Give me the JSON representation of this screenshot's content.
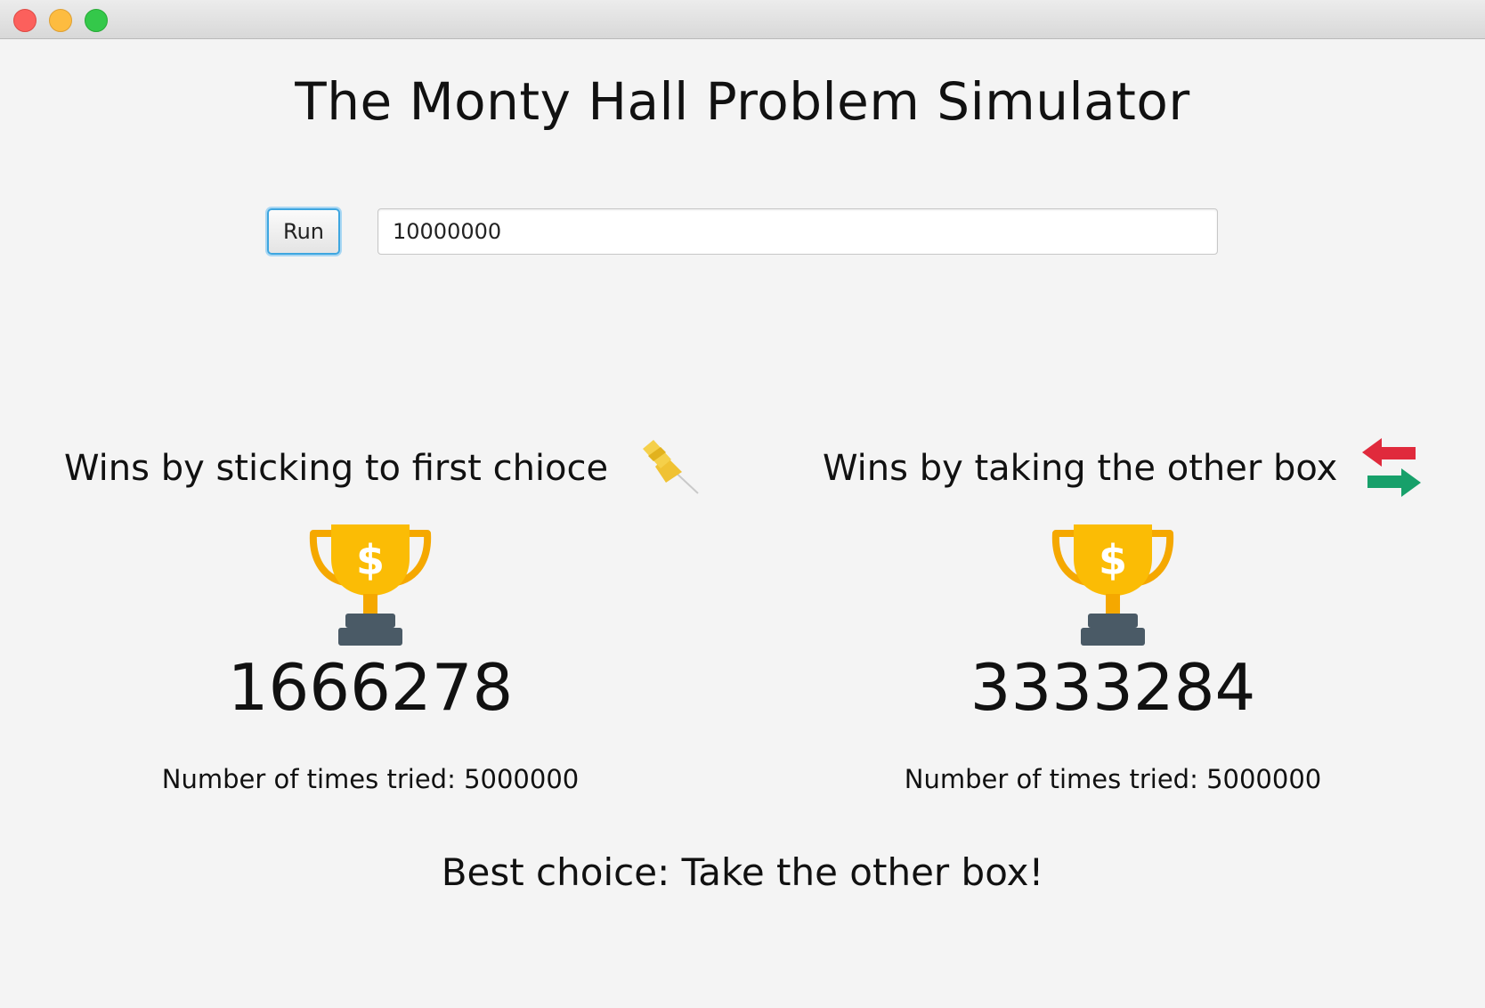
{
  "app": {
    "title": "The Monty Hall Problem Simulator"
  },
  "controls": {
    "run_label": "Run",
    "iterations_value": "10000000"
  },
  "stick_panel": {
    "heading": "Wins by sticking to first chioce",
    "icon": "pushpin-icon",
    "trophy_icon": "trophy-dollar-icon",
    "wins": "1666278",
    "tries_label": "Number of times tried: 5000000"
  },
  "switch_panel": {
    "heading": "Wins by taking the other box",
    "icon": "swap-arrows-icon",
    "trophy_icon": "trophy-dollar-icon",
    "wins": "3333284",
    "tries_label": "Number of times tried: 5000000"
  },
  "result": {
    "best_choice": "Best choice: Take the other box!"
  },
  "colors": {
    "window_bg": "#f4f4f4",
    "focus_blue": "#3ea6e0",
    "trophy_gold": "#fbbc05",
    "trophy_handle": "#f5a800",
    "trophy_base": "#4a5a66",
    "swap_red": "#e02a3c",
    "swap_green": "#17a06a",
    "pin_yellow": "#f5c518"
  }
}
